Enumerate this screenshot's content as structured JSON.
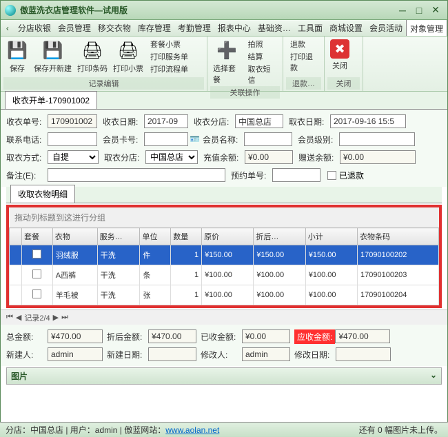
{
  "window": {
    "title": "傲蓝洗衣店管理软件—试用版"
  },
  "menu": [
    "分店收银",
    "会员管理",
    "移交衣物",
    "库存管理",
    "考勤管理",
    "报表中心",
    "基础资…",
    "工具面",
    "商城设置",
    "会员活动",
    "对象管理"
  ],
  "ribbon": {
    "g1": {
      "save": "保存",
      "saveNew": "保存开新建",
      "barcode": "打印条码",
      "receipt": "打印小票",
      "t1": "套餐小票",
      "t2": "打印服务单",
      "t3": "打印流程单",
      "cap": "记录编辑"
    },
    "g2": {
      "select": "选择套餐",
      "p1": "拍照",
      "p2": "结算",
      "p3": "取衣短信",
      "cap": "关联操作"
    },
    "g3": {
      "r1": "退款",
      "r2": "打印退款",
      "cap": "退款…"
    },
    "g4": {
      "close": "关闭",
      "cap": "关闭"
    }
  },
  "doctab": "收衣开单-170901002",
  "form": {
    "orderNoL": "收衣单号:",
    "orderNo": "170901002",
    "dateL": "收衣日期:",
    "date": "2017-09",
    "branchL": "收衣分店:",
    "branch": "中国总店",
    "pickDateL": "取衣日期:",
    "pickDate": "2017-09-16 15:5",
    "phoneL": "联系电话:",
    "phone": "",
    "cardL": "会员卡号:",
    "card": "",
    "memberL": "会员名称:",
    "member": "",
    "levelL": "会员级别:",
    "level": "",
    "pickWayL": "取衣方式:",
    "pickWay": "自提",
    "pickBranchL": "取衣分店:",
    "pickBranch": "中国总店",
    "balanceL": "充值余额:",
    "balance": "¥0.00",
    "giftL": "赠送余额:",
    "gift": "¥0.00",
    "remarkL": "备注(E):",
    "remark": "",
    "reserveL": "预约单号:",
    "reserve": "",
    "refundedL": "已退款"
  },
  "subtab": "收取衣物明细",
  "groupHint": "拖动列标题到这进行分组",
  "cols": [
    "",
    "套餐",
    "衣物",
    "服务…",
    "单位",
    "数量",
    "原价",
    "折后…",
    "小计",
    "衣物条码"
  ],
  "rows": [
    {
      "sel": true,
      "item": "羽绒服",
      "svc": "干洗",
      "unit": "件",
      "qty": "1",
      "price": "¥150.00",
      "after": "¥150.00",
      "sub": "¥150.00",
      "code": "17090100202"
    },
    {
      "sel": false,
      "item": "A西裤",
      "svc": "干洗",
      "unit": "条",
      "qty": "1",
      "price": "¥100.00",
      "after": "¥100.00",
      "sub": "¥100.00",
      "code": "17090100203"
    },
    {
      "sel": false,
      "item": "羊毛被",
      "svc": "干洗",
      "unit": "张",
      "qty": "1",
      "price": "¥100.00",
      "after": "¥100.00",
      "sub": "¥100.00",
      "code": "17090100204"
    }
  ],
  "pager": "记录2/4",
  "totals": {
    "totalL": "总金额:",
    "total": "¥470.00",
    "afterL": "折后金额:",
    "after": "¥470.00",
    "paidL": "已收金额:",
    "paid": "¥0.00",
    "dueL": "应收金额:",
    "due": "¥470.00",
    "creatorL": "新建人:",
    "creator": "admin",
    "createDateL": "新建日期:",
    "createDate": "",
    "modifierL": "修改人:",
    "modifier": "admin",
    "modifyDateL": "修改日期:",
    "modifyDate": ""
  },
  "pic": "图片",
  "status": {
    "left": "分店：中国总店 | 用户：admin | 傲蓝网站：",
    "url": "www.aolan.net",
    "right": "还有 0 幅图片未上传。"
  }
}
